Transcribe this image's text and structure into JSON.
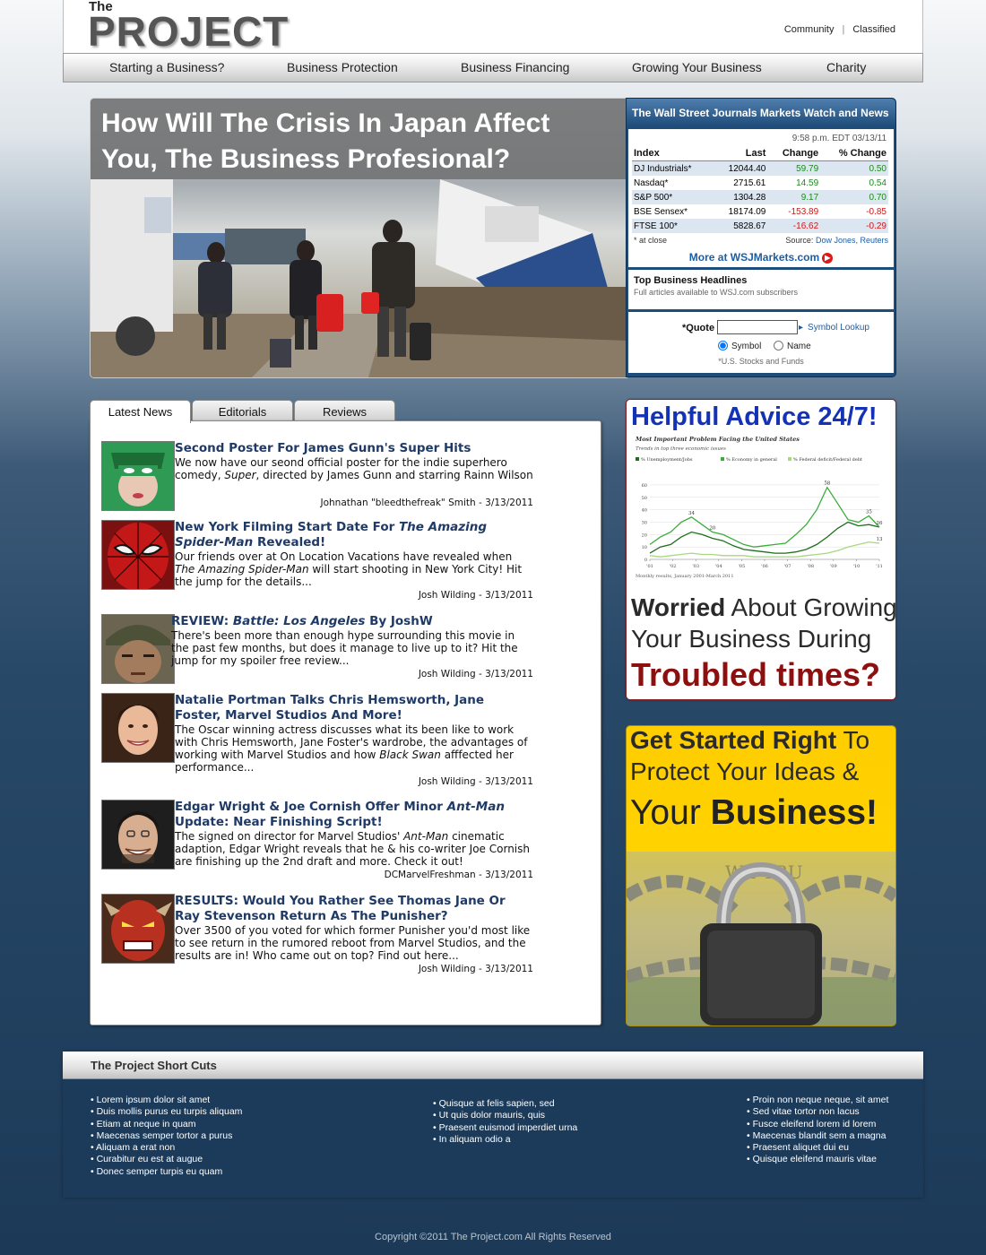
{
  "header": {
    "logo_small": "The",
    "logo": "PROJECT",
    "links": [
      "Community",
      "Classified"
    ],
    "link_separator": "|"
  },
  "nav": [
    "Starting a Business?",
    "Business Protection",
    "Business Financing",
    "Growing Your Business",
    "Charity"
  ],
  "hero": {
    "title": "How Will The Crisis In Japan Affect You, The Business Profesional?"
  },
  "wsj": {
    "title": "The Wall Street Journals Markets Watch and News",
    "timestamp": "9:58 p.m. EDT 03/13/11",
    "columns": [
      "Index",
      "Last",
      "Change",
      "% Change"
    ],
    "rows": [
      {
        "index": "DJ Industrials*",
        "last": "12044.40",
        "change": "59.79",
        "pct": "0.50"
      },
      {
        "index": "Nasdaq*",
        "last": "2715.61",
        "change": "14.59",
        "pct": "0.54"
      },
      {
        "index": "S&P 500*",
        "last": "1304.28",
        "change": "9.17",
        "pct": "0.70"
      },
      {
        "index": "BSE Sensex*",
        "last": "18174.09",
        "change": "-153.89",
        "pct": "-0.85"
      },
      {
        "index": "FTSE 100*",
        "last": "5828.67",
        "change": "-16.62",
        "pct": "-0.29"
      }
    ],
    "footnote": "* at close",
    "source_label": "Source:",
    "source_value": "Dow Jones, Reuters",
    "more_link": "More at WSJMarkets.com",
    "headlines_title": "Top Business Headlines",
    "headlines_sub": "Full articles available to WSJ.com subscribers",
    "quote_label": "*Quote",
    "quote_value": "",
    "symbol_lookup": "Symbol Lookup",
    "radio_symbol": "Symbol",
    "radio_name": "Name",
    "note": "*U.S. Stocks and Funds",
    "colors": {
      "positive": "#1c8a1c",
      "negative": "#d11717",
      "link": "#1a5ea8"
    }
  },
  "tabs": [
    "Latest News",
    "Editorials",
    "Reviews"
  ],
  "news": [
    {
      "title_parts": [
        "Second Poster For James Gunn's Super Hits"
      ],
      "body_parts": [
        "We now have our seond official poster for the indie superhero comedy, ",
        "Super",
        ", directed by James Gunn and starring Rainn Wilson"
      ],
      "author": "Johnathan \"bleedthefreak\" Smith - 3/13/2011",
      "thumb": "green-mask-poster"
    },
    {
      "title_parts": [
        "New York Filming Start Date For ",
        "The Amazing Spider-Man",
        " Revealed!"
      ],
      "body_parts": [
        "Our friends over at On Location Vacations have revealed when ",
        "The Amazing Spider-Man",
        " will start shooting in New York City! Hit the jump for the details..."
      ],
      "author": "Josh Wilding - 3/13/2011",
      "thumb": "spider-man-mask"
    },
    {
      "title_parts": [
        "REVIEW: ",
        "Battle: Los Angeles",
        " By JoshW"
      ],
      "body_parts": [
        "There's been more than enough hype surrounding this movie in the past few months, but does it manage to live up to it? Hit the jump for my spoiler free review..."
      ],
      "author": "Josh Wilding - 3/13/2011",
      "thumb": "soldier-face"
    },
    {
      "title_parts": [
        "Natalie Portman Talks Chris Hemsworth, Jane Foster, Marvel Studios And More!"
      ],
      "body_parts": [
        "The Oscar winning actress discusses what its been like to work with Chris Hemsworth, Jane Foster's wardrobe, the advantages of working with Marvel Studios and how ",
        "Black Swan",
        " afffected her performance..."
      ],
      "author": "Josh Wilding - 3/13/2011",
      "thumb": "smiling-woman"
    },
    {
      "title_parts": [
        "Edgar Wright & Joe Cornish Offer Minor ",
        "Ant-Man",
        " Update: Near Finishing Script!"
      ],
      "body_parts": [
        "The signed on director for Marvel Studios' ",
        "Ant-Man",
        " cinematic adaption, Edgar Wright reveals that he & his co-writer Joe Cornish are finishing up the 2nd draft and more. Check it out!"
      ],
      "author": "DCMarvelFreshman - 3/13/2011",
      "thumb": "smiling-man"
    },
    {
      "title_parts": [
        "RESULTS: Would You Rather See Thomas Jane Or Ray Stevenson Return As The Punisher?"
      ],
      "body_parts": [
        "Over 3500 of you voted for which former Punisher you'd most like to see return in the rumored reboot from Marvel Studios, and the results are in! Who came out on top? Find out here..."
      ],
      "author": "Josh Wilding - 3/13/2011",
      "thumb": "red-villain-face"
    }
  ],
  "ad1": {
    "title": "Helpful Advice 24/7!",
    "line1_bold": "Worried",
    "line1_rest": " About Growing",
    "line2": "Your Business During",
    "line3": "Troubled times?"
  },
  "chart_data": {
    "type": "line",
    "title": "Most Important Problem Facing the United States",
    "subtitle": "Trends in top three economic issues",
    "caption": "Monthly results, January 2001-March 2011",
    "x_ticks": [
      "'01",
      "'02",
      "'03",
      "'04",
      "'05",
      "'06",
      "'07",
      "'08",
      "'09",
      "'10",
      "'11"
    ],
    "y_ticks": [
      0,
      10,
      20,
      30,
      40,
      50,
      60
    ],
    "ylim": [
      0,
      65
    ],
    "legend": [
      "% Unemployment/Jobs",
      "% Economy in general",
      "% Federal deficit/Federal debt"
    ],
    "series": [
      {
        "name": "% Unemployment/Jobs",
        "color": "#1e6e1e",
        "values": [
          5,
          10,
          12,
          18,
          22,
          20,
          17,
          15,
          11,
          8,
          7,
          6,
          5,
          5,
          6,
          8,
          12,
          18,
          25,
          30,
          27,
          28,
          26
        ]
      },
      {
        "name": "% Economy in general",
        "color": "#38ae38",
        "values": [
          12,
          18,
          22,
          30,
          34,
          28,
          22,
          20,
          16,
          12,
          10,
          11,
          12,
          13,
          20,
          28,
          40,
          58,
          45,
          32,
          30,
          35,
          26
        ]
      },
      {
        "name": "% Federal deficit/Federal debt",
        "color": "#a8d880",
        "values": [
          3,
          2,
          3,
          4,
          5,
          4,
          4,
          3,
          3,
          3,
          2,
          2,
          2,
          2,
          2,
          3,
          4,
          5,
          7,
          10,
          12,
          14,
          13
        ]
      }
    ],
    "annotations": [
      {
        "series": 1,
        "index": 4,
        "label": "34"
      },
      {
        "series": 1,
        "index": 6,
        "label": "20"
      },
      {
        "series": 1,
        "index": 17,
        "label": "58"
      },
      {
        "series": 1,
        "index": 21,
        "label": "35"
      },
      {
        "series": 0,
        "index": 22,
        "label": "26"
      },
      {
        "series": 2,
        "index": 22,
        "label": "13"
      }
    ]
  },
  "ad2": {
    "line1_bold": "Get Started Right",
    "line1_rest": " To",
    "line2": "Protect Your Ideas &",
    "line3_a": "Your ",
    "line3_b": "Business!"
  },
  "footer": {
    "title": "The Project Short Cuts",
    "col1": [
      "Lorem ipsum dolor sit amet",
      "Duis mollis purus eu turpis aliquam",
      "Etiam at neque in quam",
      "Maecenas semper tortor a purus",
      "Aliquam a erat non",
      "Curabitur eu est at augue",
      "Donec semper turpis eu quam"
    ],
    "col2": [
      "Quisque at felis sapien, sed",
      "Ut quis dolor mauris, quis",
      "Praesent euismod imperdiet urna",
      "In aliquam odio a"
    ],
    "col3": [
      "Proin non neque neque, sit amet",
      "Sed vitae tortor non lacus",
      "Fusce eleifend lorem id lorem",
      "Maecenas blandit sem a magna",
      "Praesent aliquet dui eu",
      "Quisque eleifend mauris vitae"
    ],
    "copyright": "Copyright ©2011 The Project.com All Rights Reserved"
  }
}
